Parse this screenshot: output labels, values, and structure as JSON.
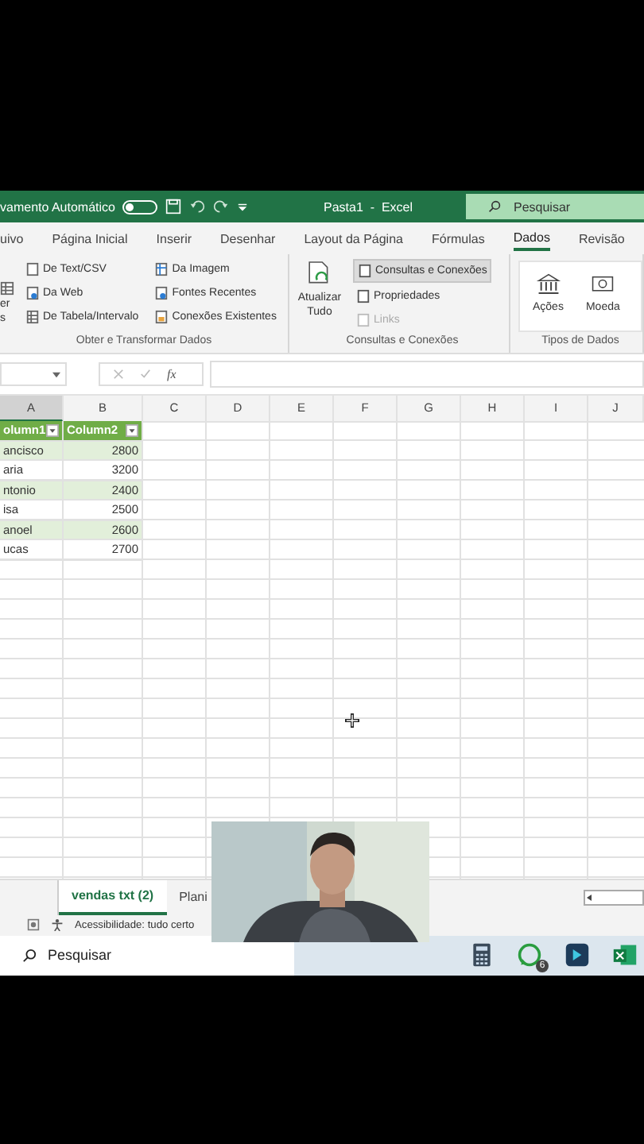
{
  "title_bar": {
    "autosave_label": "vamento Automático",
    "autosave_on": false,
    "title": "Pasta1  -  Excel",
    "search_placeholder": "Pesquisar"
  },
  "tabs": [
    {
      "label": "uivo",
      "selected": false
    },
    {
      "label": "Página Inicial",
      "selected": false
    },
    {
      "label": "Inserir",
      "selected": false
    },
    {
      "label": "Desenhar",
      "selected": false
    },
    {
      "label": "Layout da Página",
      "selected": false
    },
    {
      "label": "Fórmulas",
      "selected": false
    },
    {
      "label": "Dados",
      "selected": true
    },
    {
      "label": "Revisão",
      "selected": false
    }
  ],
  "ribbon": {
    "get_data": {
      "title": "Obter e Transformar Dados",
      "cut_button": [
        "er",
        "s"
      ],
      "column_1": [
        "De Text/CSV",
        "Da Web",
        "De Tabela/Intervalo"
      ],
      "column_2": [
        "Da Imagem",
        "Fontes Recentes",
        "Conexões Existentes"
      ]
    },
    "queries": {
      "title": "Consultas e Conexões",
      "refresh": [
        "Atualizar",
        "Tudo"
      ],
      "items": [
        {
          "label": "Consultas e Conexões",
          "selected": true,
          "disabled": false
        },
        {
          "label": "Propriedades",
          "selected": false,
          "disabled": false
        },
        {
          "label": "Links",
          "selected": false,
          "disabled": true
        }
      ]
    },
    "data_types": {
      "title": "Tipos de Dados",
      "items": [
        "Ações",
        "Moeda"
      ]
    }
  },
  "formula_bar": {
    "fx": "fx"
  },
  "grid": {
    "columns": [
      {
        "label": "A",
        "selected": true
      },
      {
        "label": "B",
        "selected": false
      },
      {
        "label": "C",
        "selected": false
      },
      {
        "label": "D",
        "selected": false
      },
      {
        "label": "E",
        "selected": false
      },
      {
        "label": "F",
        "selected": false
      },
      {
        "label": "G",
        "selected": false
      },
      {
        "label": "H",
        "selected": false
      },
      {
        "label": "I",
        "selected": false
      },
      {
        "label": "J",
        "selected": false
      }
    ],
    "table_header": [
      "olumn1",
      "Column2"
    ],
    "rows": [
      [
        "ancisco",
        "2800"
      ],
      [
        "aria",
        "3200"
      ],
      [
        "ntonio",
        "2400"
      ],
      [
        "isa",
        "2500"
      ],
      [
        "anoel",
        "2600"
      ],
      [
        "ucas",
        "2700"
      ]
    ]
  },
  "sheet_tabs": [
    {
      "label": "vendas txt (2)",
      "selected": true
    },
    {
      "label": "Plani",
      "selected": false
    }
  ],
  "status_bar": {
    "accessibility": "Acessibilidade: tudo certo"
  },
  "taskbar": {
    "search_placeholder": "Pesquisar",
    "whatsapp_badge": "6"
  }
}
